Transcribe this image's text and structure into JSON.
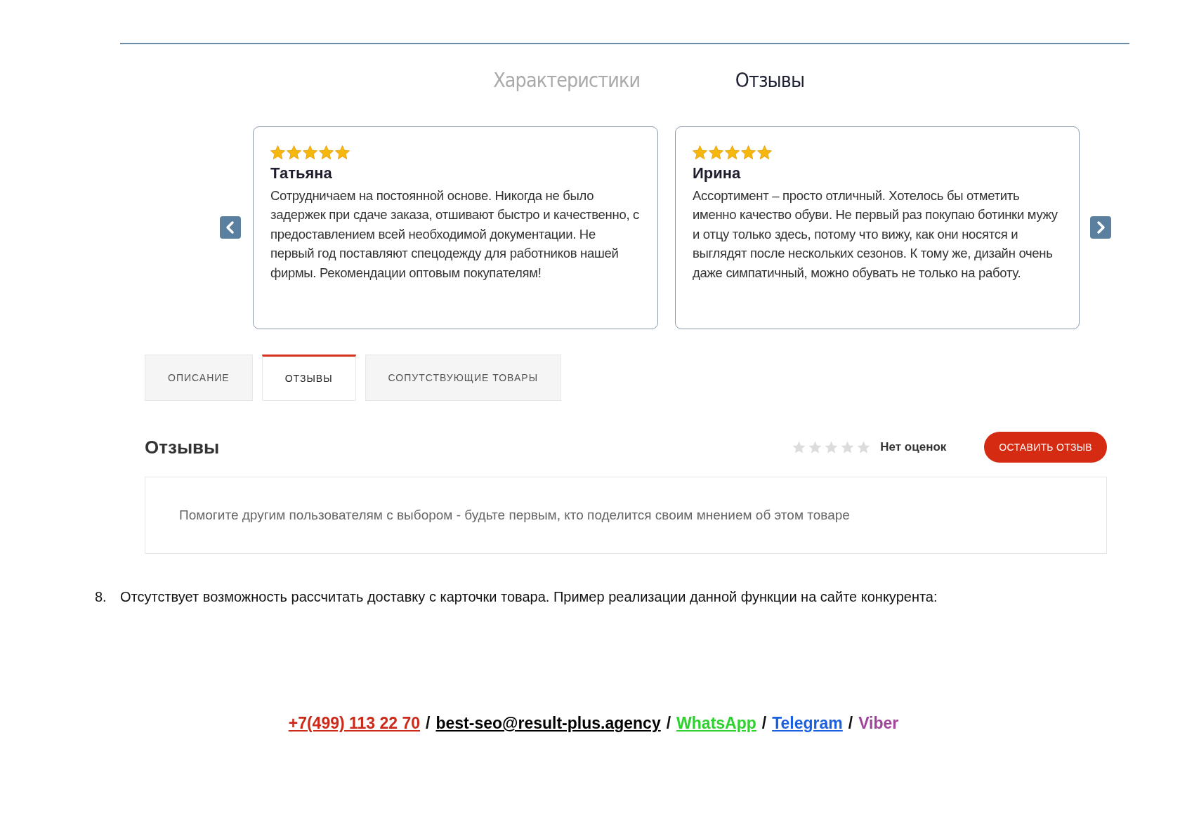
{
  "top_tabs": [
    {
      "label": "Характеристики",
      "selected": false
    },
    {
      "label": "Отзывы",
      "selected": true
    }
  ],
  "reviews": [
    {
      "stars": 5,
      "name": "Татьяна",
      "text": "Сотрудничаем на постоянной основе. Никогда не было задержек при сдаче заказа, отшивают быстро и качественно, с предоставлением всей необходимой документации. Не первый год поставляют спецодежду для работников нашей фирмы. Рекомендации оптовым покупателям!"
    },
    {
      "stars": 5,
      "name": "Ирина",
      "text": "Ассортимент – просто отличный. Хотелось бы отметить именно качество обуви. Не первый раз покупаю ботинки мужу и отцу только здесь, потому что вижу, как они носятся и выглядят после нескольких сезонов. К тому же, дизайн очень даже симпатичный, можно обувать не только на работу."
    }
  ],
  "product_tabs": [
    {
      "label": "ОПИСАНИЕ",
      "selected": false
    },
    {
      "label": "ОТЗЫВЫ",
      "selected": true
    },
    {
      "label": "СОПУТСТВУЮЩИЕ ТОВАРЫ",
      "selected": false
    }
  ],
  "reviews_section": {
    "title": "Отзывы",
    "stars": 0,
    "rating_text": "Нет оценок",
    "button": "ОСТАВИТЬ ОТЗЫВ",
    "empty_message": "Помогите другим пользователям с выбором - будьте первым, кто поделится своим мнением об этом товаре"
  },
  "note": {
    "number": "8.",
    "text": "Отсутствует возможность рассчитать доставку с карточки товара. Пример реализации данной функции на сайте конкурента:"
  },
  "footer": [
    {
      "kind": "link",
      "text": "+7(499) 113 22 70",
      "color": "#cc2a1a"
    },
    {
      "kind": "separator",
      "text": "/"
    },
    {
      "kind": "link",
      "text": "best-seo@result-plus.agency",
      "color": "#000000"
    },
    {
      "kind": "separator",
      "text": "/"
    },
    {
      "kind": "link",
      "text": "WhatsApp",
      "color": "#2ed12e"
    },
    {
      "kind": "separator",
      "text": "/"
    },
    {
      "kind": "link",
      "text": "Telegram",
      "color": "#1a5fe0"
    },
    {
      "kind": "separator",
      "text": "/"
    },
    {
      "kind": "text",
      "text": "Viber",
      "color": "#a0449a"
    }
  ]
}
